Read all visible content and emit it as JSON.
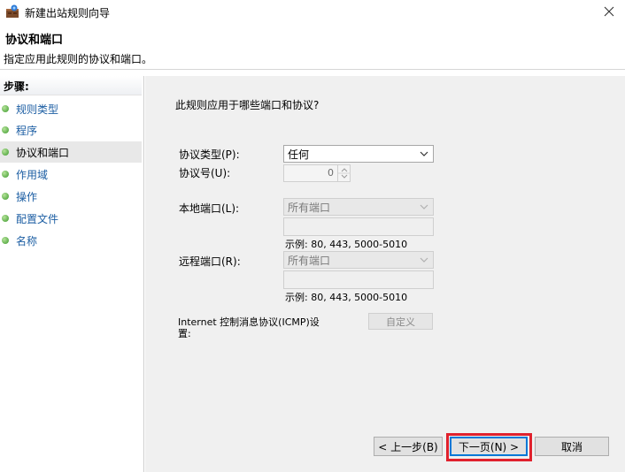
{
  "window": {
    "title": "新建出站规则向导"
  },
  "header": {
    "title": "协议和端口",
    "subtitle": "指定应用此规则的协议和端口。"
  },
  "sidebar": {
    "heading": "步骤:",
    "items": [
      {
        "label": "规则类型"
      },
      {
        "label": "程序"
      },
      {
        "label": "协议和端口"
      },
      {
        "label": "作用域"
      },
      {
        "label": "操作"
      },
      {
        "label": "配置文件"
      },
      {
        "label": "名称"
      }
    ],
    "active_index": 2
  },
  "main": {
    "question": "此规则应用于哪些端口和协议?",
    "protocol_type": {
      "label": "协议类型(P):",
      "value": "任何"
    },
    "protocol_number": {
      "label": "协议号(U):",
      "value": "0"
    },
    "local_port": {
      "label": "本地端口(L):",
      "value": "所有端口",
      "example": "示例: 80, 443, 5000-5010"
    },
    "remote_port": {
      "label": "远程端口(R):",
      "value": "所有端口",
      "example": "示例: 80, 443, 5000-5010"
    },
    "icmp": {
      "label_line1": "Internet 控制消息协议(ICMP)设",
      "label_line2": "置:",
      "button": "自定义"
    }
  },
  "buttons": {
    "back": "< 上一步(B)",
    "next": "下一页(N) >",
    "cancel": "取消"
  },
  "colors": {
    "highlight": "#e0212d",
    "link": "#1c5ea3",
    "accent": "#0078d7"
  }
}
